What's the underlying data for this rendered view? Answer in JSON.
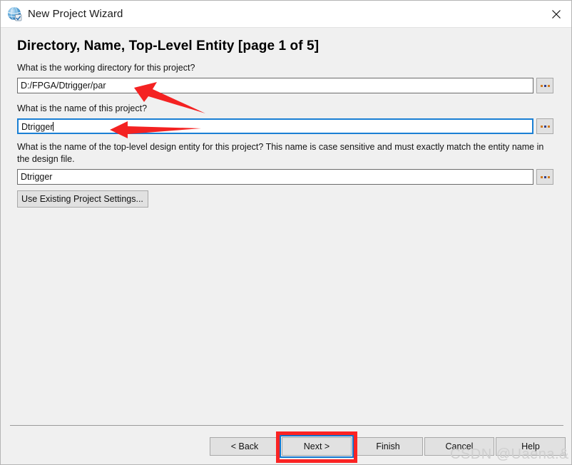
{
  "window": {
    "title": "New Project Wizard",
    "icon": "globe-icon",
    "close_label": "close-icon"
  },
  "page": {
    "heading": "Directory, Name, Top-Level Entity [page 1 of 5]",
    "page_number": 1,
    "page_total": 5
  },
  "fields": {
    "working_directory": {
      "label": "What is the working directory for this project?",
      "value": "D:/FPGA/Dtrigger/par",
      "browse_label": "...",
      "focused": false
    },
    "project_name": {
      "label": "What is the name of this project?",
      "value": "Dtrigger",
      "browse_label": "...",
      "focused": true
    },
    "top_level_entity": {
      "label": "What is the name of the top-level design entity for this project? This name is case sensitive and must exactly match the entity name in the design file.",
      "value": "Dtrigger",
      "browse_label": "...",
      "focused": false
    }
  },
  "buttons": {
    "use_existing": "Use Existing Project Settings...",
    "back": "< Back",
    "next": "Next >",
    "finish": "Finish",
    "cancel": "Cancel",
    "help": "Help"
  },
  "annotations": {
    "watermark": "CSDN @Uaena.&",
    "highlight_color": "#fb2323",
    "focus_color": "#1076ce"
  }
}
